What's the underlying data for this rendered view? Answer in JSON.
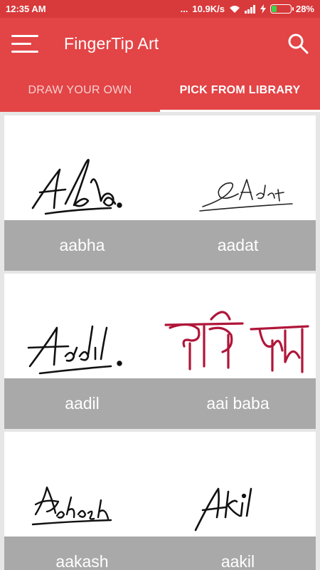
{
  "status_bar": {
    "time": "12:35 AM",
    "dots": "...",
    "net_speed": "10.9K/s",
    "battery": "28%",
    "battery_level": 0.28
  },
  "app_bar": {
    "title": "FingerTip Art",
    "menu_icon": "hamburger-menu-icon",
    "search_icon": "search-icon"
  },
  "tabs": [
    {
      "label": "DRAW YOUR OWN",
      "active": false
    },
    {
      "label": "PICK FROM LIBRARY",
      "active": true
    }
  ],
  "library": [
    {
      "name": "aabha"
    },
    {
      "name": "aadat"
    },
    {
      "name": "aadil"
    },
    {
      "name": "aai baba"
    },
    {
      "name": "aakash"
    },
    {
      "name": "aakil"
    }
  ],
  "colors": {
    "app_bar": "#e34446",
    "status_bar": "#d8393b",
    "label_bar": "#a9a9a9"
  }
}
